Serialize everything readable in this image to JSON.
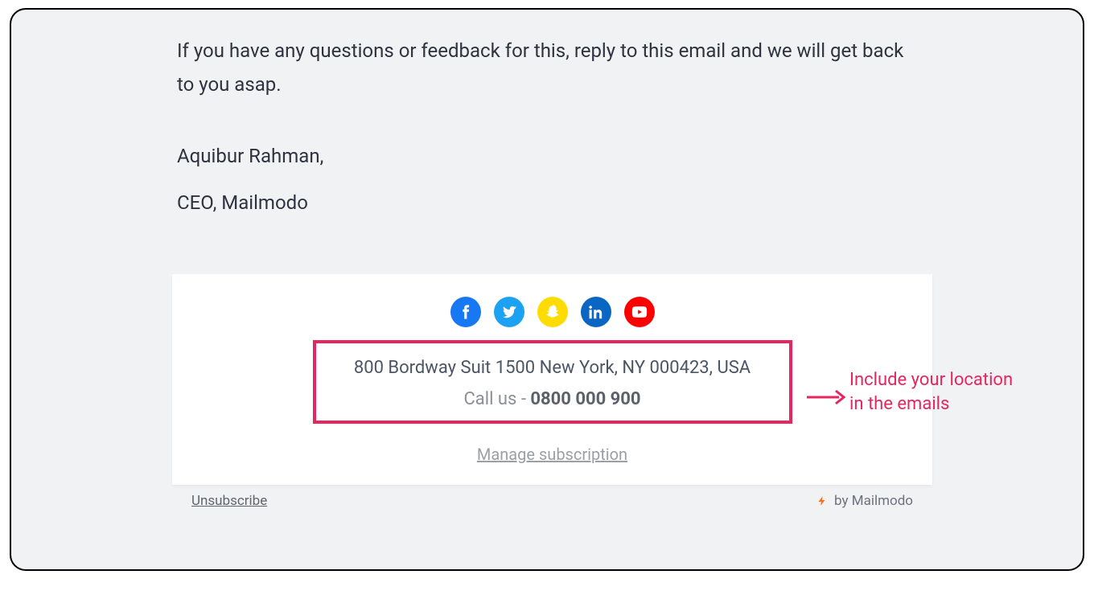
{
  "body": {
    "text": "If you have any questions or feedback for this, reply to this email and we will get back to you asap."
  },
  "signature": {
    "name": "Aquibur Rahman,",
    "title": "CEO, Mailmodo"
  },
  "footer": {
    "address": "800 Bordway Suit 1500 New York, NY 000423, USA",
    "call_prefix": "Call us - ",
    "phone": "0800 000 900",
    "manage_label": "Manage subscription"
  },
  "bar": {
    "unsubscribe": "Unsubscribe",
    "brand": "by Mailmodo"
  },
  "annotation": {
    "line1": "Include your location",
    "line2": "in the emails"
  },
  "social": {
    "facebook": "facebook-icon",
    "twitter": "twitter-icon",
    "snapchat": "snapchat-icon",
    "linkedin": "linkedin-icon",
    "youtube": "youtube-icon"
  }
}
